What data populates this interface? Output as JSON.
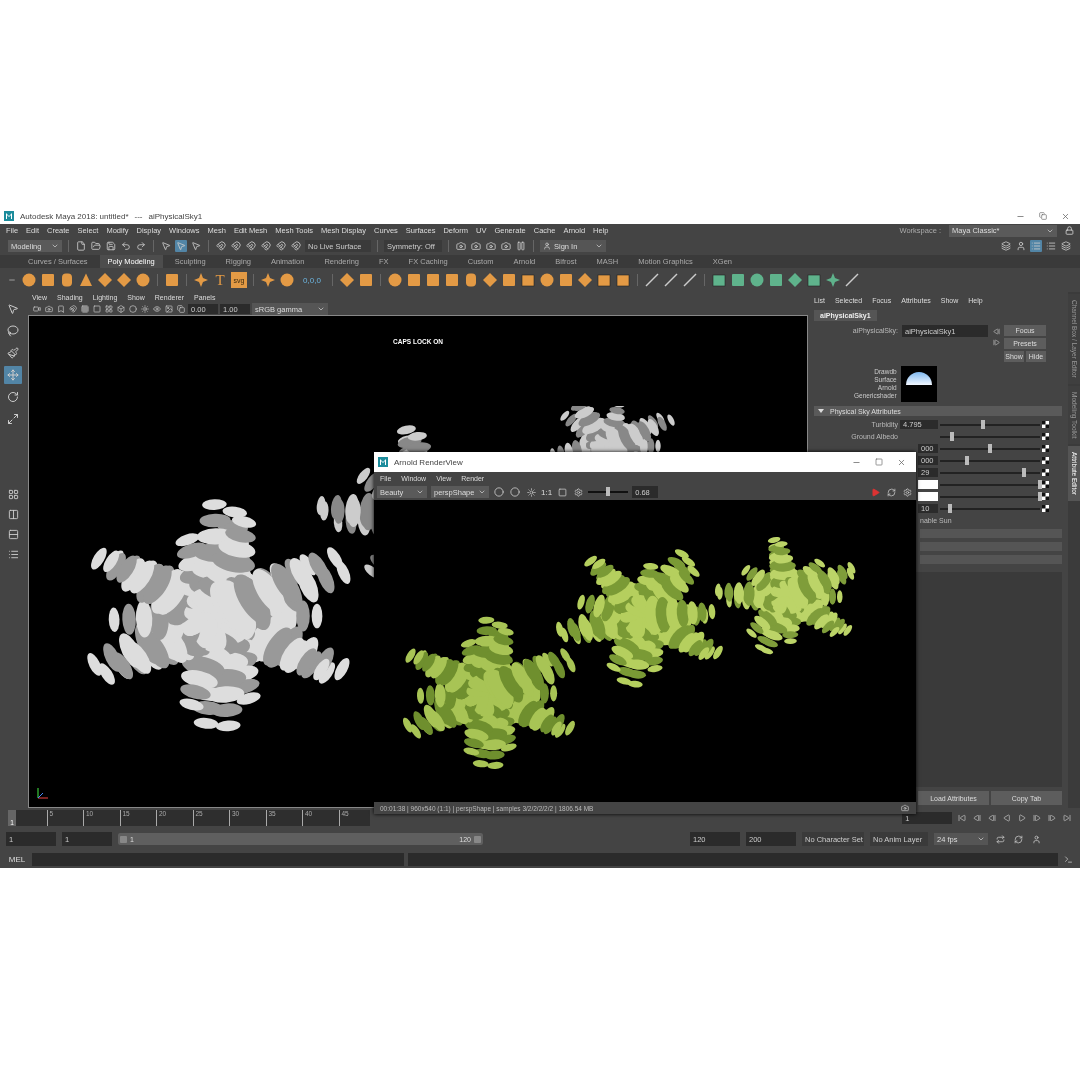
{
  "title_bar": {
    "app_title": "Autodesk Maya 2018: untitled*",
    "separator": "---",
    "node": "aiPhysicalSky1"
  },
  "menu_bar": {
    "items": [
      "File",
      "Edit",
      "Create",
      "Select",
      "Modify",
      "Display",
      "Windows",
      "Mesh",
      "Edit Mesh",
      "Mesh Tools",
      "Mesh Display",
      "Curves",
      "Surfaces",
      "Deform",
      "UV",
      "Generate",
      "Cache",
      "Arnold",
      "Help"
    ],
    "workspace_label": "Workspace :",
    "workspace": "Maya Classic*"
  },
  "status_line": {
    "mode": "Modeling",
    "live_surface": "No Live Surface",
    "symmetry": "Symmetry: Off",
    "sign_in": "Sign In"
  },
  "shelf": {
    "tabs": [
      {
        "label": "Curves / Surfaces",
        "selected": false
      },
      {
        "label": "Poly Modeling",
        "selected": true
      },
      {
        "label": "Sculpting",
        "selected": false
      },
      {
        "label": "Rigging",
        "selected": false
      },
      {
        "label": "Animation",
        "selected": false
      },
      {
        "label": "Rendering",
        "selected": false
      },
      {
        "label": "FX",
        "selected": false
      },
      {
        "label": "FX Caching",
        "selected": false
      },
      {
        "label": "Custom",
        "selected": false
      },
      {
        "label": "Arnold",
        "selected": false
      },
      {
        "label": "Bifrost",
        "selected": false
      },
      {
        "label": "MASH",
        "selected": false
      },
      {
        "label": "Motion Graphics",
        "selected": false
      },
      {
        "label": "XGen",
        "selected": false
      }
    ],
    "text_icons": [
      "T",
      "svg"
    ],
    "coordinates_icon": "0,0,0"
  },
  "toolbox": {
    "tools": [
      {
        "selected": false
      },
      {
        "selected": false
      },
      {
        "selected": false
      },
      {
        "selected": true
      },
      {
        "selected": false
      },
      {
        "selected": false
      }
    ]
  },
  "viewport": {
    "menus": [
      "View",
      "Shading",
      "Lighting",
      "Show",
      "Renderer",
      "Panels"
    ],
    "exposure": "0.00",
    "gamma": "1.00",
    "color_space": "sRGB gamma",
    "message": "CAPS LOCK ON"
  },
  "attribute_editor": {
    "menus": [
      "List",
      "Selected",
      "Focus",
      "Attributes",
      "Show",
      "Help"
    ],
    "tab": "aiPhysicalSky1",
    "node_label": "aiPhysicalSky:",
    "node_name": "aiPhysicalSky1",
    "buttons": [
      "Focus",
      "Presets",
      "Show",
      "Hide"
    ],
    "swatch_labels": [
      "Drawdb",
      "Surface",
      "Arnold",
      "Genericshader"
    ],
    "section": {
      "title": "Physical Sky Attributes",
      "expanded": true
    },
    "rows": [
      {
        "kind": "number",
        "label": "Turbidity",
        "value": "4.795",
        "level": 0.43
      },
      {
        "kind": "number",
        "label": "Ground Albedo",
        "level": 0.12
      },
      {
        "kind": "number",
        "value": "000",
        "level": 0.5
      },
      {
        "kind": "number",
        "value": "000",
        "level": 0.27
      },
      {
        "kind": "number",
        "value": "29",
        "level": 0.84
      },
      {
        "kind": "color",
        "level": 1
      },
      {
        "kind": "color",
        "level": 1
      },
      {
        "kind": "number",
        "value": "10",
        "level": 0.1
      },
      {
        "kind": "checkbox",
        "label": "nable Sun"
      }
    ],
    "bottom_buttons": [
      "Load Attributes",
      "Copy Tab"
    ]
  },
  "side_tabs": [
    {
      "label": "Channel Box / Layer Editor",
      "selected": false
    },
    {
      "label": "Modeling Toolkit",
      "selected": false
    },
    {
      "label": "Attribute Editor",
      "selected": true
    }
  ],
  "render_view": {
    "title": "Arnold RenderView",
    "menus": [
      "File",
      "Window",
      "View",
      "Render"
    ],
    "aov": "Beauty",
    "camera": "perspShape",
    "ratio": "1:1",
    "exposure": {
      "level": 0.5,
      "reading": "0.68"
    },
    "status": "00:01:38 | 960x540 (1:1) | perspShape  | samples 3/2/2/2/2/2 | 1806.54 MB"
  },
  "time_slider": {
    "current_frame": "1",
    "level": 0,
    "ticks": [
      "5",
      "10",
      "15",
      "20",
      "25",
      "30",
      "35",
      "40",
      "45"
    ],
    "frame_field": "1"
  },
  "range_slider": {
    "level": 1,
    "start": "1",
    "range_start": "1",
    "range_min": "1",
    "range_max": "120",
    "range_end": "120",
    "end": "200",
    "character_set": "No Character Set",
    "anim_layer": "No Anim Layer",
    "fps": "24 fps"
  },
  "command_line": {
    "language": "MEL"
  }
}
